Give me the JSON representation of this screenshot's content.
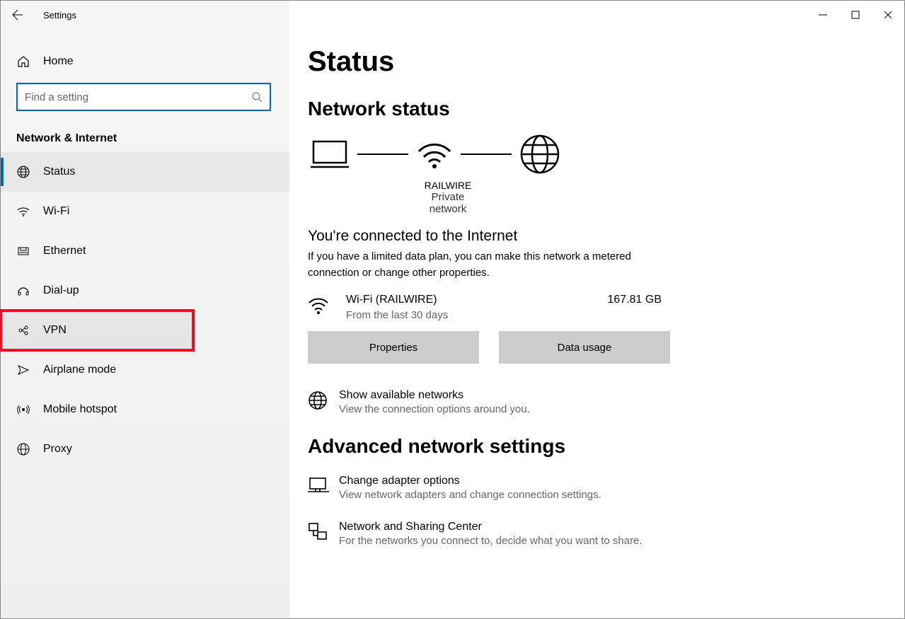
{
  "window": {
    "title": "Settings"
  },
  "sidebar": {
    "home": "Home",
    "search_placeholder": "Find a setting",
    "group": "Network & Internet",
    "items": [
      {
        "label": "Status"
      },
      {
        "label": "Wi-Fi"
      },
      {
        "label": "Ethernet"
      },
      {
        "label": "Dial-up"
      },
      {
        "label": "VPN"
      },
      {
        "label": "Airplane mode"
      },
      {
        "label": "Mobile hotspot"
      },
      {
        "label": "Proxy"
      }
    ]
  },
  "content": {
    "page_title": "Status",
    "section1": "Network status",
    "diagram": {
      "name": "RAILWIRE",
      "type": "Private network"
    },
    "connected_heading": "You're connected to the Internet",
    "connected_desc": "If you have a limited data plan, you can make this network a metered connection or change other properties.",
    "wifi": {
      "name": "Wi-Fi (RAILWIRE)",
      "sub": "From the last 30 days",
      "usage": "167.81 GB"
    },
    "buttons": {
      "properties": "Properties",
      "data_usage": "Data usage"
    },
    "show_available": {
      "title": "Show available networks",
      "sub": "View the connection options around you."
    },
    "section2": "Advanced network settings",
    "adapter": {
      "title": "Change adapter options",
      "sub": "View network adapters and change connection settings."
    },
    "sharing": {
      "title": "Network and Sharing Center",
      "sub": "For the networks you connect to, decide what you want to share."
    }
  }
}
